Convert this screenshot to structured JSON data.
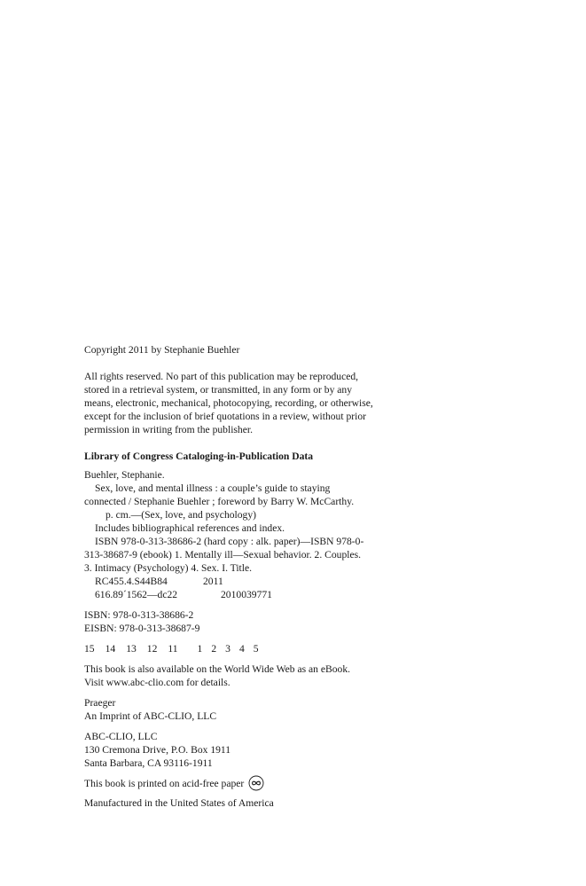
{
  "copyright": "Copyright 2011 by Stephanie Buehler",
  "rights": [
    "All rights reserved. No part of this publication may be reproduced,",
    "stored in a retrieval system, or transmitted, in any form or by any",
    "means, electronic, mechanical, photocopying, recording, or otherwise,",
    "except for the inclusion of brief quotations in a review, without prior",
    "permission in writing from the publisher."
  ],
  "cip": {
    "heading": "Library of Congress Cataloging-in-Publication Data",
    "author": "Buehler, Stephanie.",
    "title_line1": "Sex, love, and mental illness : a couple’s guide to staying",
    "title_line2": "connected / Stephanie Buehler ; foreword by Barry W. McCarthy.",
    "series": "p. cm.—(Sex, love, and psychology)",
    "notes": "Includes bibliographical references and index.",
    "isbn_line1": "ISBN 978-0-313-38686-2 (hard copy : alk. paper)—ISBN 978-0-",
    "isbn_line2": "313-38687-9 (ebook) 1. Mentally ill—Sexual behavior. 2. Couples.",
    "isbn_line3": "3. Intimacy (Psychology) 4. Sex. I. Title.",
    "lc_class": "RC455.4.S44B84",
    "lc_year": "2011",
    "dewey": "616.89´1562—dc22",
    "lccn": "2010039771"
  },
  "isbn": "ISBN: 978-0-313-38686-2",
  "eisbn": "EISBN: 978-0-313-38687-9",
  "printing_left": [
    "15",
    "14",
    "13",
    "12",
    "11"
  ],
  "printing_right": [
    "1",
    "2",
    "3",
    "4",
    "5"
  ],
  "ebook_line1": "This book is also available on the World Wide Web as an eBook.",
  "ebook_line2": "Visit www.abc-clio.com for details.",
  "imprint_name": "Praeger",
  "imprint_of": "An Imprint of ABC-CLIO, LLC",
  "publisher_name": "ABC-CLIO, LLC",
  "publisher_address1": "130 Cremona Drive, P.O. Box 1911",
  "publisher_address2": "Santa Barbara, CA 93116-1911",
  "acid_free": "This book is printed on acid-free paper",
  "acid_icon": "infinity-circle-icon",
  "manufactured": "Manufactured in the United States of America"
}
